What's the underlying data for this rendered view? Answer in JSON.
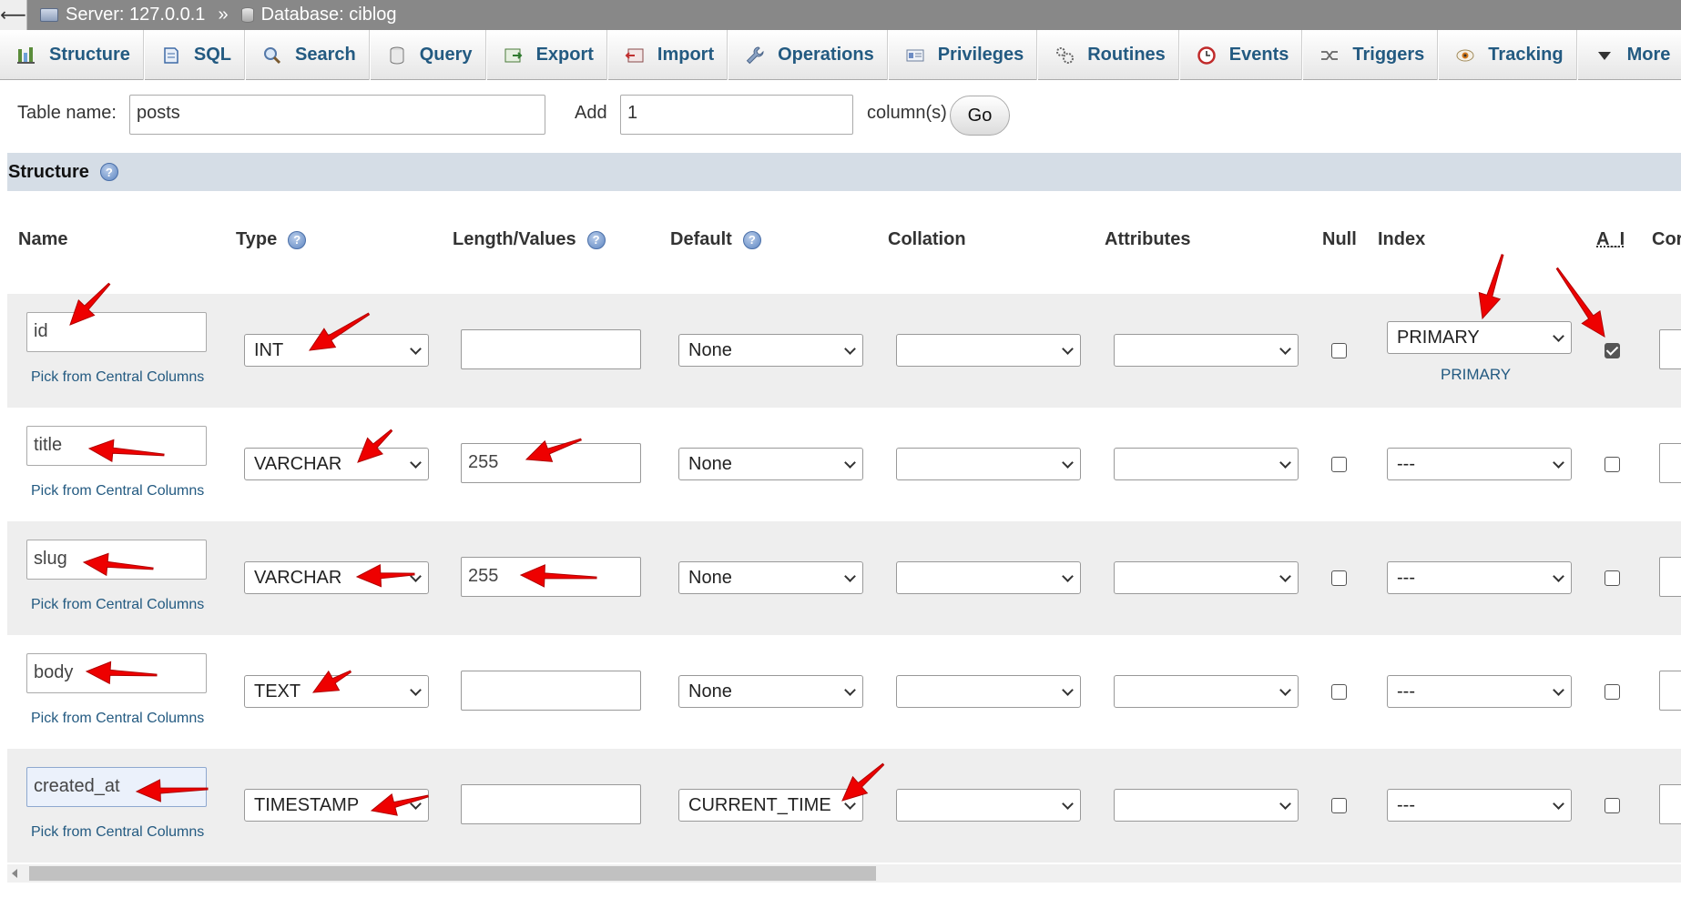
{
  "breadcrumb": {
    "back_glyph": "⟵",
    "server": "Server: 127.0.0.1",
    "separator": "»",
    "database": "Database: ciblog"
  },
  "tabs": [
    {
      "label": "Structure",
      "icon": "structure-icon"
    },
    {
      "label": "SQL",
      "icon": "sql-icon"
    },
    {
      "label": "Search",
      "icon": "search-icon"
    },
    {
      "label": "Query",
      "icon": "query-icon"
    },
    {
      "label": "Export",
      "icon": "export-icon"
    },
    {
      "label": "Import",
      "icon": "import-icon"
    },
    {
      "label": "Operations",
      "icon": "wrench-icon"
    },
    {
      "label": "Privileges",
      "icon": "privileges-icon"
    },
    {
      "label": "Routines",
      "icon": "routines-icon"
    },
    {
      "label": "Events",
      "icon": "clock-icon"
    },
    {
      "label": "Triggers",
      "icon": "triggers-icon"
    },
    {
      "label": "Tracking",
      "icon": "eye-icon"
    },
    {
      "label": "More",
      "icon": "caret-down-icon"
    }
  ],
  "form": {
    "table_name_label": "Table name:",
    "table_name_value": "posts",
    "add_label": "Add",
    "add_value": "1",
    "columns_label": "column(s)",
    "go_label": "Go"
  },
  "structure": {
    "title": "Structure",
    "help_glyph": "?"
  },
  "columns": {
    "name": "Name",
    "type": "Type",
    "length": "Length/Values",
    "default": "Default",
    "collation": "Collation",
    "attributes": "Attributes",
    "null": "Null",
    "index": "Index",
    "ai": "A_I",
    "comments": "Cor"
  },
  "pick_label": "Pick from Central Columns",
  "rows": [
    {
      "name": "id",
      "type": "INT",
      "length": "",
      "default": "None",
      "collation": "",
      "attributes": "",
      "null": false,
      "index": "PRIMARY",
      "index_note": "PRIMARY",
      "ai": true
    },
    {
      "name": "title",
      "type": "VARCHAR",
      "length": "255",
      "default": "None",
      "collation": "",
      "attributes": "",
      "null": false,
      "index": "---",
      "index_note": "",
      "ai": false
    },
    {
      "name": "slug",
      "type": "VARCHAR",
      "length": "255",
      "default": "None",
      "collation": "",
      "attributes": "",
      "null": false,
      "index": "---",
      "index_note": "",
      "ai": false
    },
    {
      "name": "body",
      "type": "TEXT",
      "length": "",
      "default": "None",
      "collation": "",
      "attributes": "",
      "null": false,
      "index": "---",
      "index_note": "",
      "ai": false
    },
    {
      "name": "created_at",
      "type": "TIMESTAMP",
      "length": "",
      "default": "CURRENT_TIME",
      "collation": "",
      "attributes": "",
      "null": false,
      "index": "---",
      "index_note": "",
      "ai": false
    }
  ],
  "colors": {
    "link": "#235a81",
    "annotation_arrow": "#ee0000",
    "section_header": "#d5dde6"
  }
}
